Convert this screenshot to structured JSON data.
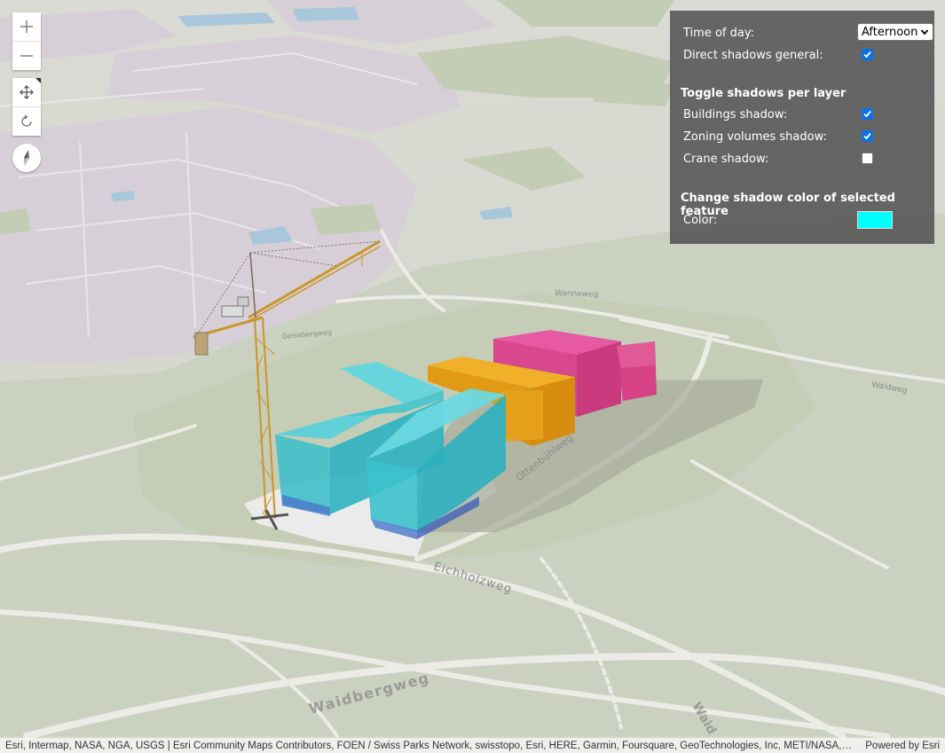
{
  "map": {
    "street_labels": {
      "eichholzweg": "Eichholzweg",
      "waidbergweg": "Waidbergweg",
      "waid": "Waid",
      "ottenbuehlweg": "Ottenbühlweg",
      "wanneweg": "Wanneweg",
      "waldweg": "Waldweg",
      "geissbergweg": "Geissbergweg"
    },
    "colors": {
      "ground": "#d6d8cf",
      "urban": "#d5cfd6",
      "green": "#c6cdb6",
      "water": "#a9c7db",
      "zoning_cyan": "#2ec9d3",
      "zoning_orange": "#e6a21c",
      "zoning_pink": "#e64f9e",
      "crane": "#d9a93a"
    }
  },
  "navigation": {
    "zoom_in_icon": "plus-icon",
    "zoom_out_icon": "minus-icon",
    "pan_icon": "pan-arrows-icon",
    "rotate_icon": "rotate-icon",
    "compass_icon": "compass-needle-icon"
  },
  "panel": {
    "time_of_day": {
      "label": "Time of day:",
      "selected": "Afternoon"
    },
    "direct_shadows": {
      "label": "Direct shadows general:",
      "checked": true
    },
    "toggle_section_title": "Toggle shadows per layer",
    "buildings_shadow": {
      "label": "Buildings shadow:",
      "checked": true
    },
    "zoning_shadow": {
      "label": "Zoning volumes shadow:",
      "checked": true
    },
    "crane_shadow": {
      "label": "Crane shadow:",
      "checked": false
    },
    "color_section_title": "Change shadow color of selected feature",
    "color": {
      "label": "Color:",
      "value": "#00ffff"
    }
  },
  "attribution": {
    "credits": "Esri, Intermap, NASA, NGA, USGS | Esri Community Maps Contributors, FOEN / Swiss Parks Network, swisstopo, Esri, HERE, Garmin, Foursquare, GeoTechnologies, Inc, METI/NASA, USGS",
    "powered": "Powered by Esri"
  }
}
